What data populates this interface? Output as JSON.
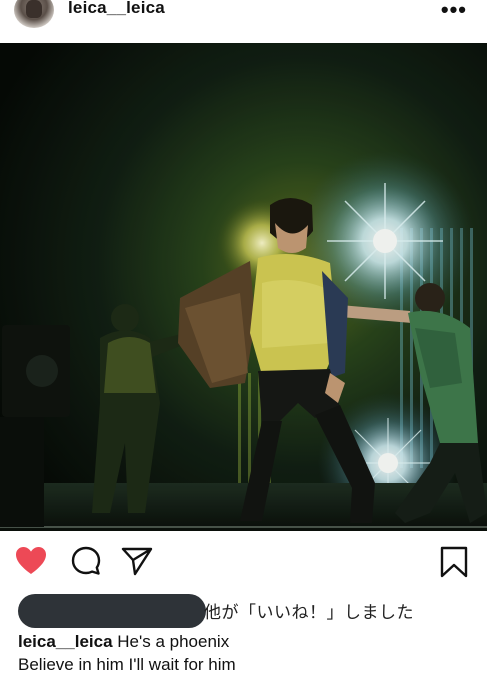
{
  "post": {
    "username": "leica__leica",
    "more_label": "•••",
    "likes_text": "他が「いいね！」しました",
    "caption_user": "leica__leica",
    "caption_line1": "He's a phoenix",
    "caption_line2": "Believe in him I'll wait for him"
  },
  "icons": {
    "like": "heart-icon",
    "comment": "comment-icon",
    "share": "send-icon",
    "save": "bookmark-icon",
    "more": "more-icon"
  },
  "colors": {
    "like_red": "#ed4956",
    "redaction": "#2e3338"
  }
}
